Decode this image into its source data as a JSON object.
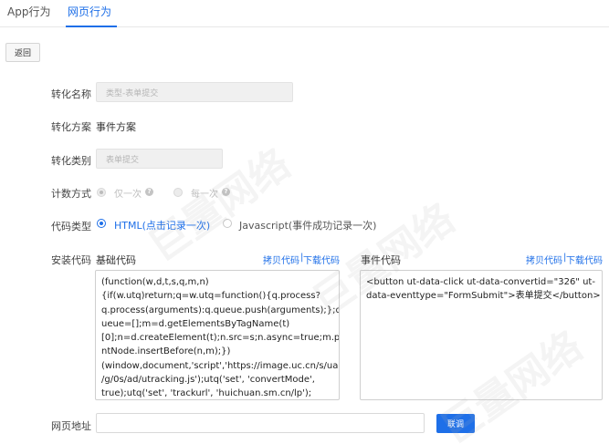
{
  "tabs": [
    {
      "label": "App行为",
      "active": false
    },
    {
      "label": "网页行为",
      "active": true
    }
  ],
  "back_button": "返回",
  "form": {
    "conversion_name": {
      "label": "转化名称",
      "placeholder": "类型-表单提交"
    },
    "conversion_plan": {
      "label": "转化方案",
      "value": "事件方案"
    },
    "conversion_type": {
      "label": "转化类别",
      "placeholder": "表单提交"
    },
    "count_method": {
      "label": "计数方式",
      "options": [
        {
          "label": "仅一次",
          "selected": true,
          "disabled": true
        },
        {
          "label": "每一次",
          "selected": false,
          "disabled": true
        }
      ]
    },
    "code_type": {
      "label": "代码类型",
      "options": [
        {
          "label": "HTML(点击记录一次)",
          "selected": true
        },
        {
          "label": "Javascript(事件成功记录一次)",
          "selected": false
        }
      ]
    },
    "install_code": {
      "label": "安装代码",
      "base": {
        "title": "基础代码",
        "copy_link": "拷贝代码",
        "download_link": "下载代码",
        "separator": "|",
        "lines": [
          "(function(w,d,t,s,q,m,n)",
          "{if(w.utq)return;q=w.utq=function(){q.process?",
          "q.process(arguments):q.queue.push(arguments);};q.q",
          "ueue=[];m=d.getElementsByTagName(t)",
          "[0];n=d.createElement(t);n.src=s;n.async=true;m.pare",
          "ntNode.insertBefore(n,m);})",
          "(window,document,'script','https://image.uc.cn/s/uae",
          "/g/0s/ad/utracking.js');utq('set', 'convertMode',",
          "true);utq('set', 'trackurl', 'huichuan.sm.cn/lp');"
        ]
      },
      "event": {
        "title": "事件代码",
        "copy_link": "拷贝代码",
        "download_link": "下载代码",
        "separator": "|",
        "lines": [
          "<button ut-data-click ut-data-convertid=\"326\" ut-",
          "data-eventtype=\"FormSubmit\">表单提交</button>"
        ]
      }
    },
    "page_url": {
      "label": "网页地址",
      "value": ""
    },
    "debug_button": "联调"
  },
  "watermark": "巨量网络"
}
